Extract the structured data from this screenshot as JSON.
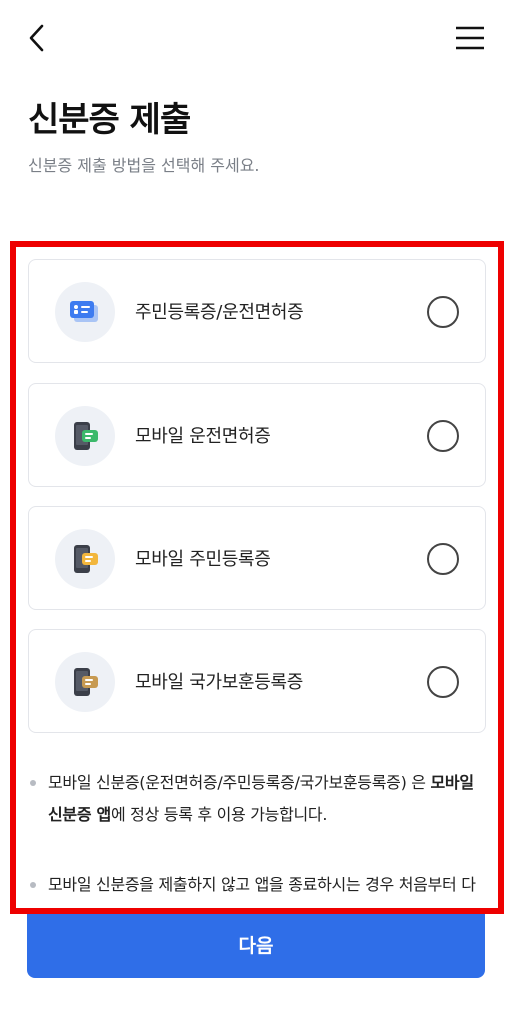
{
  "header": {
    "back_icon": "chevron-left-icon",
    "menu_icon": "hamburger-menu-icon"
  },
  "page": {
    "title": "신분증 제출",
    "subtitle": "신분증 제출 방법을 선택해 주세요."
  },
  "options": [
    {
      "label": "주민등록증/운전면허증",
      "icon": "id-card-icon",
      "accent": "#3d7bf0",
      "selected": false
    },
    {
      "label": "모바일 운전면허증",
      "icon": "mobile-driver-license-icon",
      "accent": "#3cb96b",
      "selected": false
    },
    {
      "label": "모바일 주민등록증",
      "icon": "mobile-resident-card-icon",
      "accent": "#f2b63c",
      "selected": false
    },
    {
      "label": "모바일 국가보훈등록증",
      "icon": "mobile-veteran-card-icon",
      "accent": "#c79a52",
      "selected": false
    }
  ],
  "notes": {
    "note1_pre": "모바일 신분증(운전면허증/주민등록증/국가보훈등록증) 은 ",
    "note1_bold": "모바일 신분증 앱",
    "note1_post": "에 정상 등록 후 이용 가능합니다.",
    "note2": "모바일 신분증을 제출하지 않고 앱을 종료하시는 경우 처음부터 다시 진행해 주셔야 합니다."
  },
  "footer": {
    "next_label": "다음",
    "primary_color": "#2f6ee8"
  },
  "highlight": {
    "border_color": "#ee0000"
  }
}
